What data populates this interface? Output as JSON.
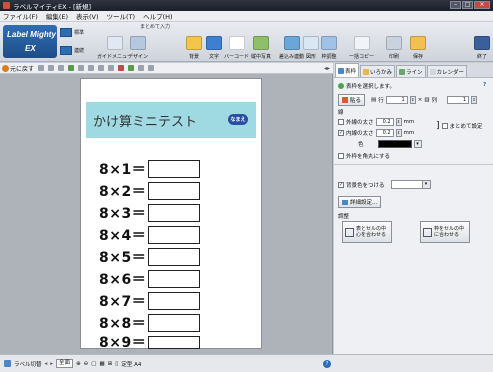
{
  "window": {
    "title": "ラベルマイティEX - [新規]",
    "buttons": [
      "–",
      "□",
      "×"
    ]
  },
  "menu": [
    "ファイル(F)",
    "編集(E)",
    "表示(V)",
    "ツール(T)",
    "ヘルプ(H)"
  ],
  "ribbon": {
    "logo_line1": "Label Mighty",
    "logo_line2": "EX",
    "modes": [
      "標準",
      "連続"
    ],
    "group_label": "まとめて入力",
    "tools": [
      {
        "label": "ガイドメニュー",
        "color": "#e0e8f4"
      },
      {
        "label": "デザイン",
        "color": "#b6c8e0"
      },
      {
        "label": "背景",
        "color": "#f2c64a"
      },
      {
        "label": "文字",
        "color": "#3f7fcf"
      },
      {
        "label": "バーコード",
        "color": "#ffffff"
      },
      {
        "label": "縦中写真",
        "color": "#8fbf6a"
      },
      {
        "label": "差込み連動",
        "color": "#6aa7d8"
      },
      {
        "label": "図形",
        "color": "#d9e7f5"
      },
      {
        "label": "枠調整",
        "color": "#9fc2e6"
      },
      {
        "label": "一括コピー",
        "color": "#f0f3f7"
      },
      {
        "label": "印刷",
        "color": "#c9d3df"
      },
      {
        "label": "保存",
        "color": "#f0c050"
      },
      {
        "label": "終了",
        "color": "#3a5f9a"
      }
    ]
  },
  "toolbar": {
    "back_label": "元に戻す"
  },
  "document": {
    "title": "かけ算ミニテスト",
    "badge": "なまえ",
    "problems": [
      "8×1＝",
      "8×2＝",
      "8×3＝",
      "8×4＝",
      "8×5＝",
      "8×6＝",
      "8×7＝",
      "8×8＝",
      "8×9＝"
    ]
  },
  "panel": {
    "tabs": [
      "表枠",
      "いろかみ",
      "ライン",
      "カレンダー"
    ],
    "hint": "表枠を選択します。",
    "help": "?",
    "paste_label": "貼る",
    "rows_label": "行",
    "rows_value": "1",
    "cols_sep": "×",
    "cols_label": "列",
    "cols_value": "1",
    "line_heading": "線",
    "outer_label": "外線の太さ",
    "outer_value": "0.2",
    "inner_label": "内線の太さ",
    "inner_value": "0.2",
    "unit": "mm",
    "merge_label": "まとめて設定",
    "color_label": "色",
    "round_label": "外枠を角丸にする",
    "bg_label": "背景色をつける",
    "detail_label": "詳細設定...",
    "adjust_heading": "調整",
    "center_btn": "表とセルの中心を合わせる",
    "fit_btn": "枠をセルの中に合わせる"
  },
  "status": {
    "label_switch": "ラベル切替",
    "zoom": "全面",
    "paper": "定型 A4"
  }
}
